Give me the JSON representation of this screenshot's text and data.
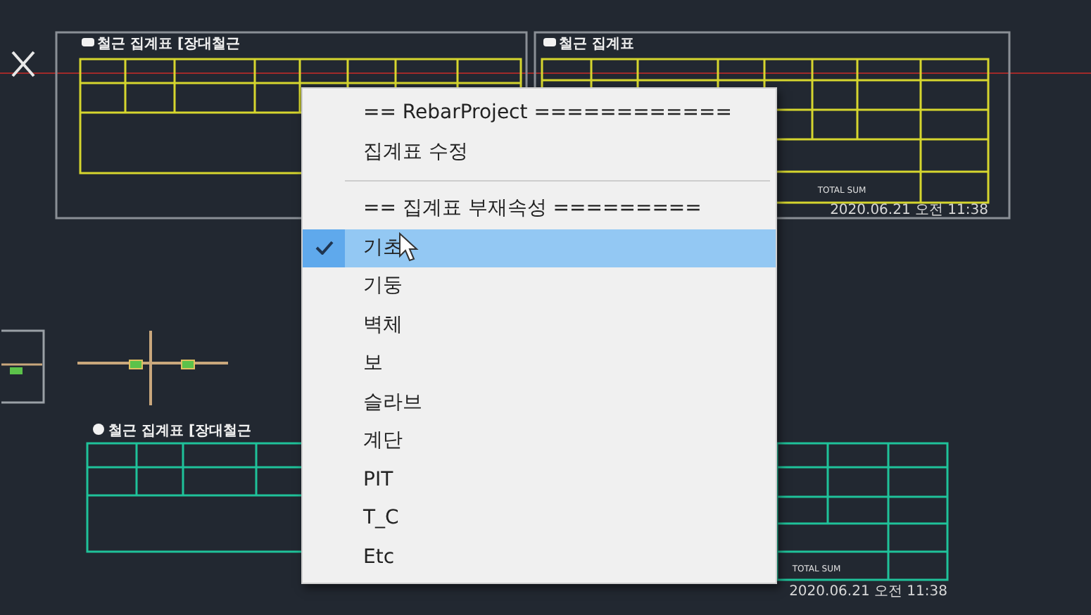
{
  "tables": [
    {
      "title": "철근 집계표 [장대철근",
      "color": "#d6d62e"
    },
    {
      "title": "철근 집계표",
      "color": "#d6d62e",
      "total_label": "TOTAL SUM",
      "date": "2020.06.21 오전 11:38"
    },
    {
      "title": "철근 집계표 [장대철근",
      "color": "#1fc29a",
      "total_label": "TOTAL SUM",
      "date": "2020.06.21 오전 11:38"
    }
  ],
  "context_menu": {
    "items": [
      {
        "kind": "header",
        "label": "== RebarProject ============"
      },
      {
        "kind": "item",
        "label": "집계표 수정",
        "checked": false,
        "selected": false
      },
      {
        "kind": "separator"
      },
      {
        "kind": "header",
        "label": "== 집계표 부재속성 ========="
      },
      {
        "kind": "item",
        "label": "기초",
        "checked": true,
        "selected": true
      },
      {
        "kind": "item",
        "label": "기둥",
        "checked": false,
        "selected": false
      },
      {
        "kind": "item",
        "label": "벽체",
        "checked": false,
        "selected": false
      },
      {
        "kind": "item",
        "label": "보",
        "checked": false,
        "selected": false
      },
      {
        "kind": "item",
        "label": "슬라브",
        "checked": false,
        "selected": false
      },
      {
        "kind": "item",
        "label": "계단",
        "checked": false,
        "selected": false
      },
      {
        "kind": "item",
        "label": "PIT",
        "checked": false,
        "selected": false
      },
      {
        "kind": "item",
        "label": "T_C",
        "checked": false,
        "selected": false
      },
      {
        "kind": "item",
        "label": "Etc",
        "checked": false,
        "selected": false
      }
    ]
  }
}
